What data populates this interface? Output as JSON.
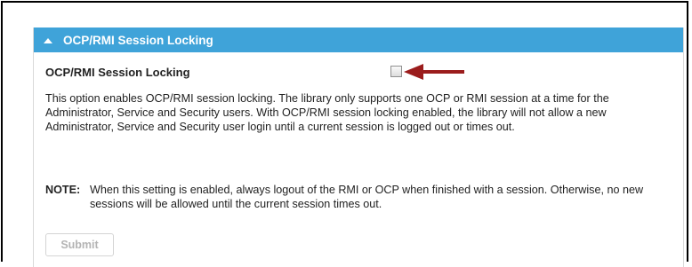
{
  "panel": {
    "title": "OCP/RMI Session Locking",
    "setting_label": "OCP/RMI Session Locking",
    "checkbox_checked": false,
    "description": "This option enables OCP/RMI session locking. The library only supports one OCP or RMI session at a time for the Administrator, Service and Security users. With OCP/RMI session locking enabled, the library will not allow a new Administrator, Service and Security user login until a current session is logged out or times out.",
    "note_label": "NOTE:",
    "note_text": "When this setting is enabled, always logout of the RMI or OCP when finished with a session. Otherwise, no new sessions will be allowed until the current session times out.",
    "submit_label": "Submit"
  },
  "icons": {
    "collapse": "triangle-up-icon",
    "annotation": "arrow-left-icon"
  },
  "colors": {
    "header_bg": "#3fa3d9",
    "arrow": "#9b1c1c",
    "submit_disabled_text": "#b4b4b4"
  }
}
